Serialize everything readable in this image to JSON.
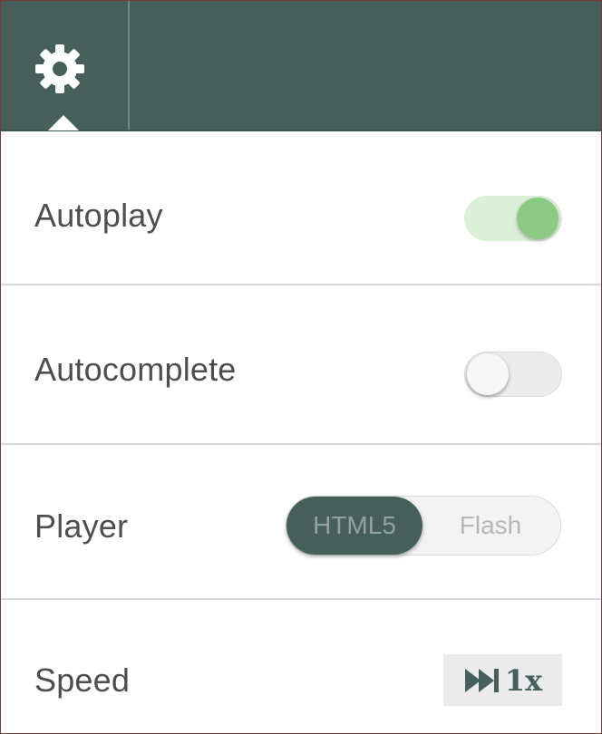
{
  "header": {
    "settings_icon": "gear-icon"
  },
  "settings": [
    {
      "key": "autoplay",
      "label": "Autoplay",
      "control": "toggle",
      "state": "on"
    },
    {
      "key": "autocomplete",
      "label": "Autocomplete",
      "control": "toggle",
      "state": "off"
    },
    {
      "key": "player",
      "label": "Player",
      "control": "segmented",
      "options": [
        "HTML5",
        "Flash"
      ],
      "selected": "HTML5"
    },
    {
      "key": "speed",
      "label": "Speed",
      "control": "button",
      "icon": "fast-forward-icon",
      "value": "1x"
    }
  ],
  "colors": {
    "header_bg": "#465f58",
    "toggle_on_knob": "#8cc983",
    "toggle_on_track": "#dcf0d8",
    "label_text": "#4e4e4e"
  }
}
